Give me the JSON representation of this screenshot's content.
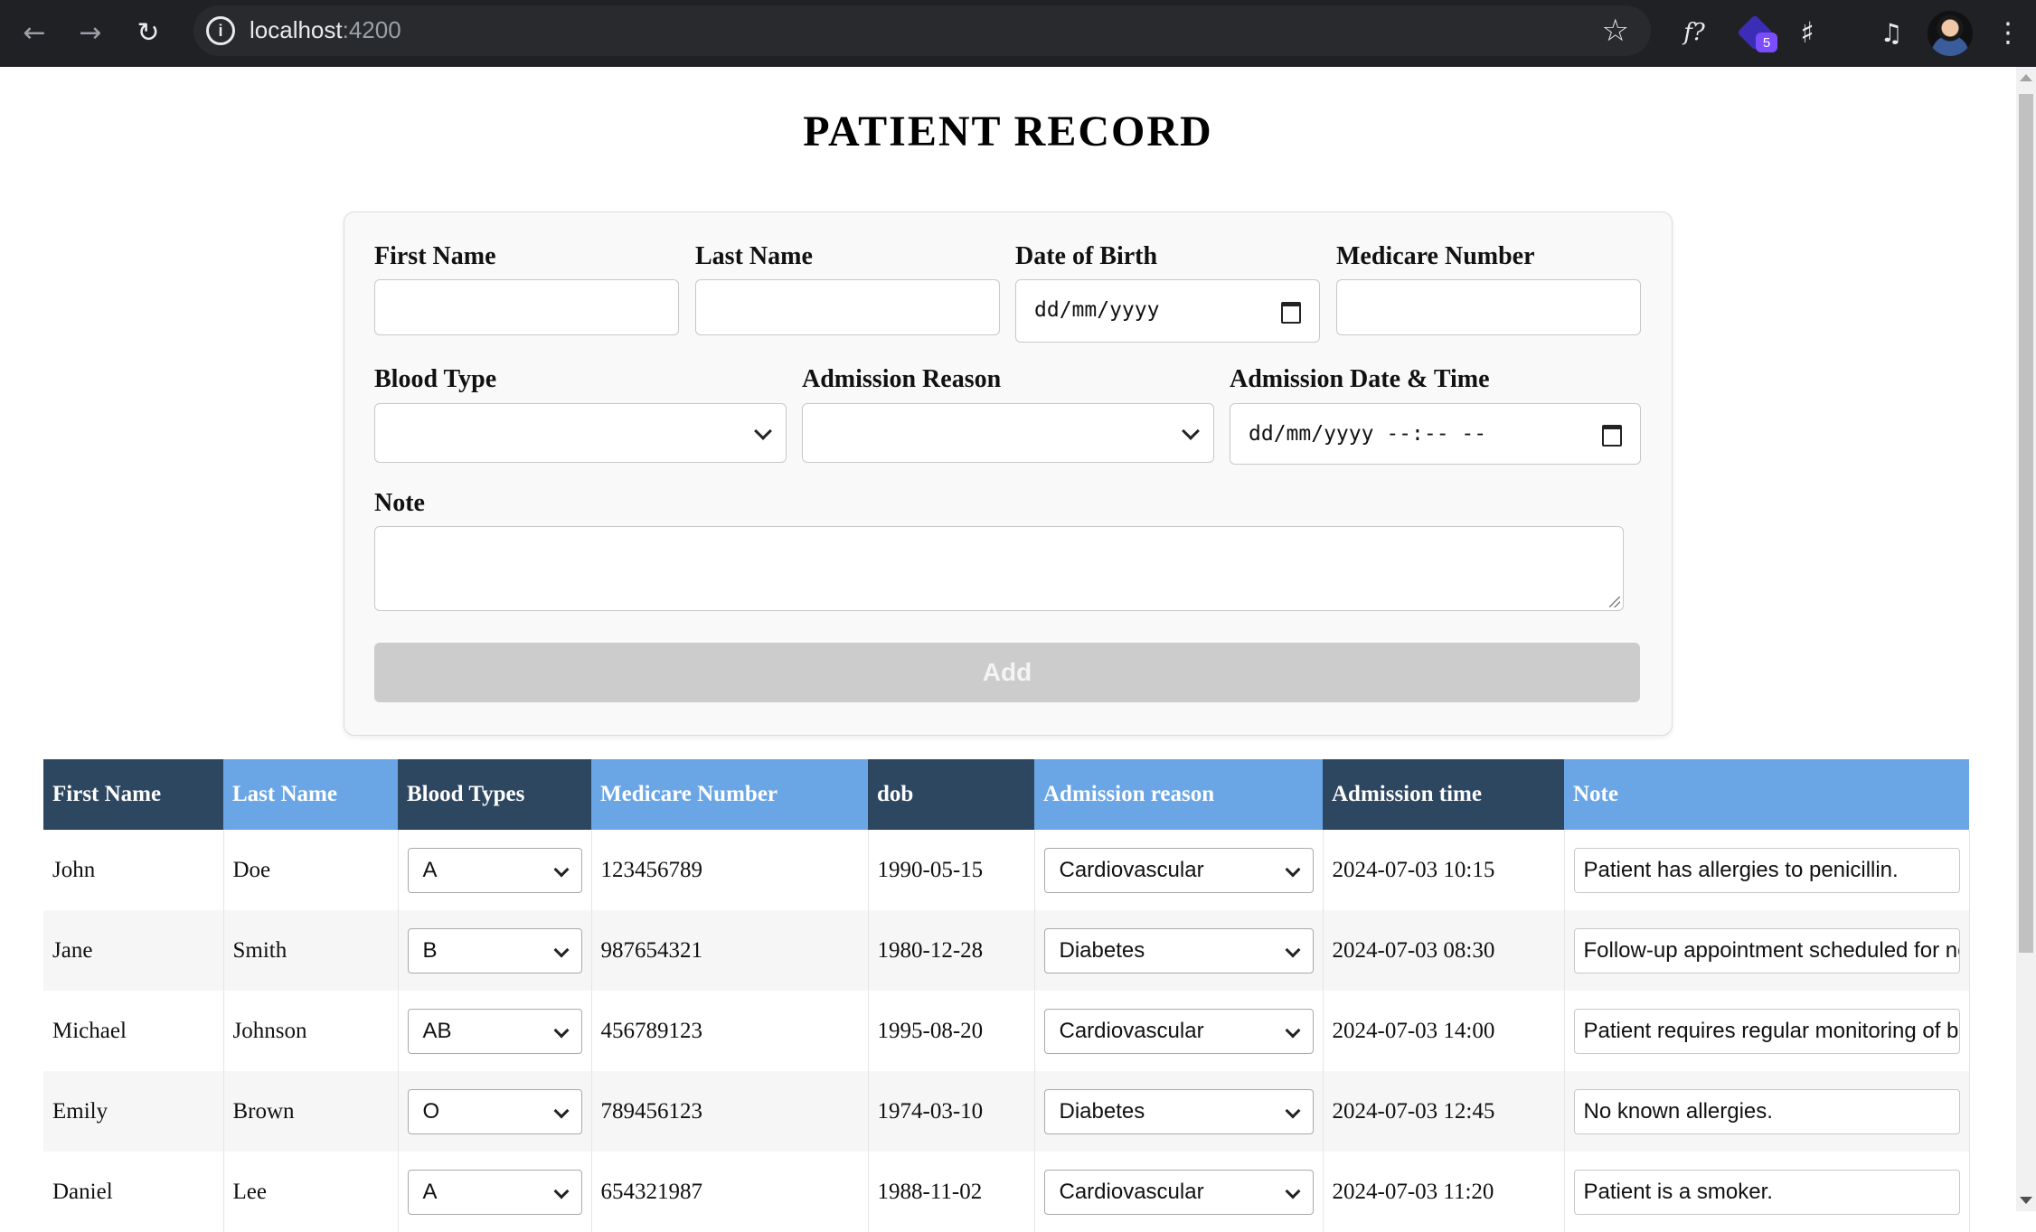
{
  "browser": {
    "url_host": "localhost",
    "url_port": ":4200",
    "extension_badge_count": "5",
    "icons": [
      "back-icon",
      "forward-icon",
      "reload-icon",
      "site-info-icon",
      "bookmark-star-icon",
      "formula-extension-icon",
      "extension-badge-icon",
      "puzzle-extensions-icon",
      "media-control-icon",
      "profile-avatar",
      "kebab-menu-icon"
    ]
  },
  "page": {
    "title": "PATIENT RECORD"
  },
  "form": {
    "first_name_label": "First Name",
    "last_name_label": "Last Name",
    "dob_label": "Date of Birth",
    "dob_placeholder": "dd/mm/yyyy",
    "medicare_label": "Medicare Number",
    "blood_type_label": "Blood Type",
    "admission_reason_label": "Admission Reason",
    "admission_datetime_label": "Admission Date & Time",
    "admission_datetime_placeholder": "dd/mm/yyyy --:-- --",
    "note_label": "Note",
    "add_button": "Add"
  },
  "table": {
    "headers": [
      "First Name",
      "Last Name",
      "Blood Types",
      "Medicare Number",
      "dob",
      "Admission reason",
      "Admission time",
      "Note"
    ],
    "rows": [
      {
        "first": "John",
        "last": "Doe",
        "blood": "A",
        "medicare": "123456789",
        "dob": "1990-05-15",
        "reason": "Cardiovascular",
        "time": "2024-07-03 10:15",
        "note": "Patient has allergies to penicillin."
      },
      {
        "first": "Jane",
        "last": "Smith",
        "blood": "B",
        "medicare": "987654321",
        "dob": "1980-12-28",
        "reason": "Diabetes",
        "time": "2024-07-03 08:30",
        "note": "Follow-up appointment scheduled for ne"
      },
      {
        "first": "Michael",
        "last": "Johnson",
        "blood": "AB",
        "medicare": "456789123",
        "dob": "1995-08-20",
        "reason": "Cardiovascular",
        "time": "2024-07-03 14:00",
        "note": "Patient requires regular monitoring of bl"
      },
      {
        "first": "Emily",
        "last": "Brown",
        "blood": "O",
        "medicare": "789456123",
        "dob": "1974-03-10",
        "reason": "Diabetes",
        "time": "2024-07-03 12:45",
        "note": "No known allergies."
      },
      {
        "first": "Daniel",
        "last": "Lee",
        "blood": "A",
        "medicare": "654321987",
        "dob": "1988-11-02",
        "reason": "Cardiovascular",
        "time": "2024-07-03 11:20",
        "note": "Patient is a smoker."
      }
    ]
  },
  "colors": {
    "header_dark": "#2e4761",
    "header_light": "#6aa6e6",
    "add_button_disabled": "#cccccc"
  }
}
